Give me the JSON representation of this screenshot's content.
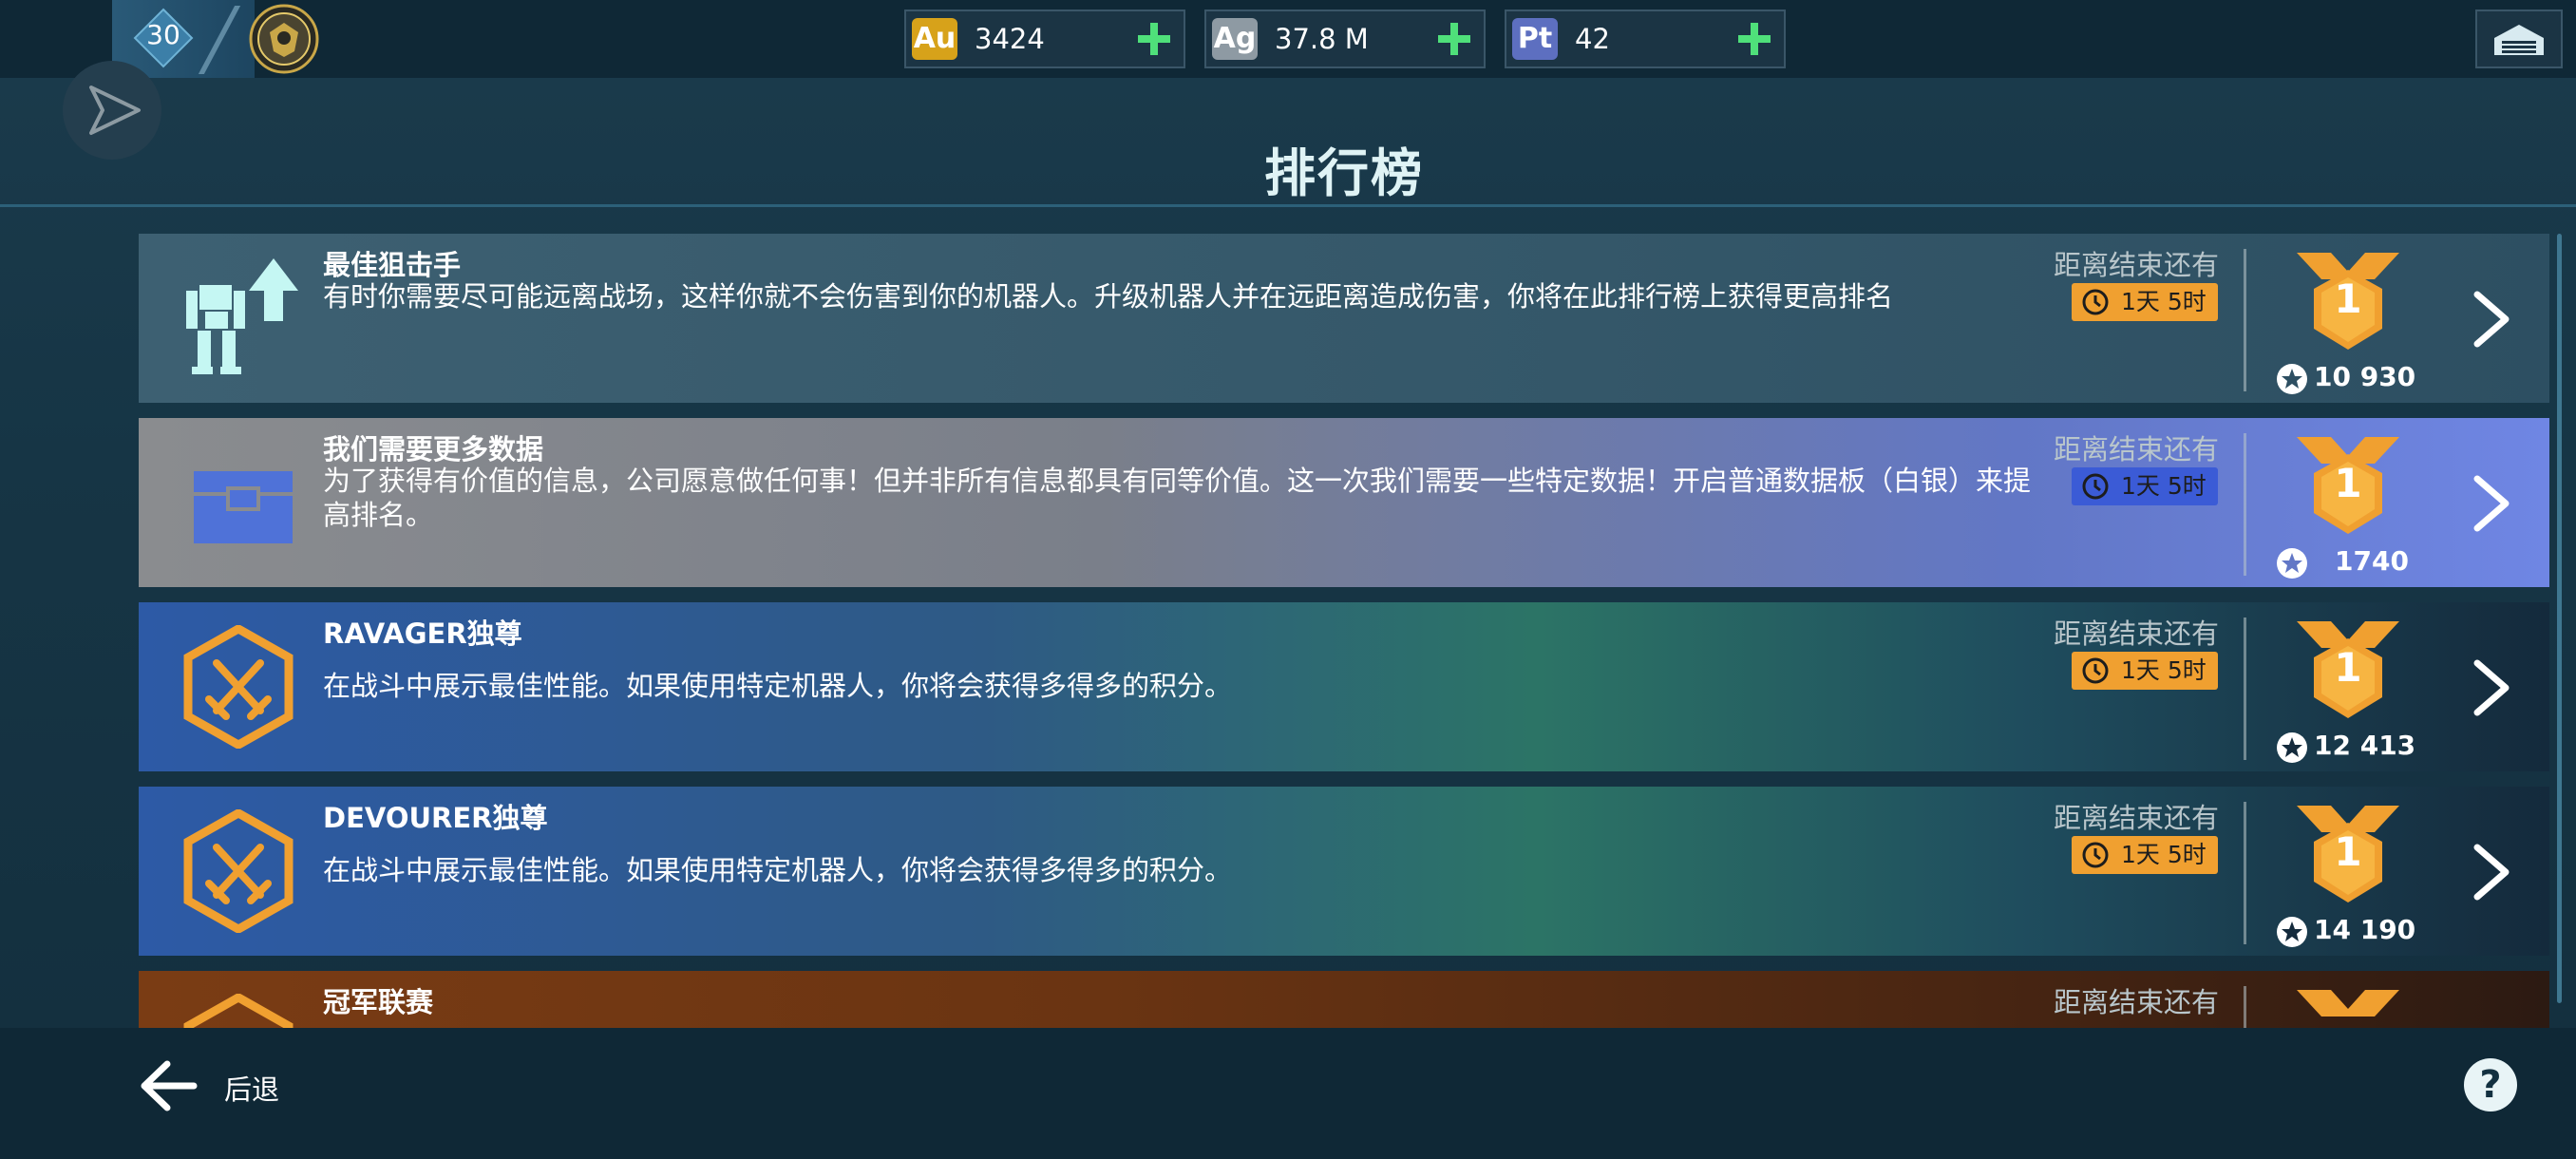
{
  "header": {
    "level": "30",
    "currencies": [
      {
        "code": "Au",
        "value": "3424",
        "icon": "gold-icon",
        "color": "#d7a21a"
      },
      {
        "code": "Ag",
        "value": "37.8 M",
        "icon": "silver-icon",
        "color": "#8e9aa3"
      },
      {
        "code": "Pt",
        "value": "42",
        "icon": "platinum-icon",
        "color": "#5d6fc0"
      }
    ],
    "icons": [
      "send-icon",
      "emblem-icon",
      "plus-icon",
      "hangar-icon"
    ]
  },
  "page": {
    "title": "排行榜"
  },
  "leaderboards": [
    {
      "title": "最佳狙击手",
      "description": "有时你需要尽可能远离战场，这样你就不会伤害到你的机器人。升级机器人并在远距离造成伤害，你将在此排行榜上获得更高排名",
      "ends_label": "距离结束还有",
      "timer": "1天 5时",
      "rank": "1",
      "score": "10 930",
      "icon": "robot-upgrade-icon"
    },
    {
      "title": "我们需要更多数据",
      "description": "为了获得有价值的信息，公司愿意做任何事！但并非所有信息都具有同等价值。这一次我们需要一些特定数据！开启普通数据板（白银）来提高排名。",
      "ends_label": "距离结束还有",
      "timer": "1天 5时",
      "rank": "1",
      "score": "1740",
      "icon": "data-chest-icon"
    },
    {
      "title": "RAVAGER独尊",
      "description": "在战斗中展示最佳性能。如果使用特定机器人，你将会获得多得多的积分。",
      "ends_label": "距离结束还有",
      "timer": "1天 5时",
      "rank": "1",
      "score": "12 413",
      "icon": "crossed-swords-icon"
    },
    {
      "title": "DEVOURER独尊",
      "description": "在战斗中展示最佳性能。如果使用特定机器人，你将会获得多得多的积分。",
      "ends_label": "距离结束还有",
      "timer": "1天 5时",
      "rank": "1",
      "score": "14 190",
      "icon": "crossed-swords-icon"
    },
    {
      "title": "冠军联赛",
      "ends_label": "距离结束还有",
      "icon": "crossed-swords-icon"
    }
  ],
  "footer": {
    "back_label": "后退",
    "help_label": "?"
  },
  "colors": {
    "accent_orange": "#f0a030",
    "timer_blue": "#3b5bd6",
    "background": "#14303f"
  }
}
